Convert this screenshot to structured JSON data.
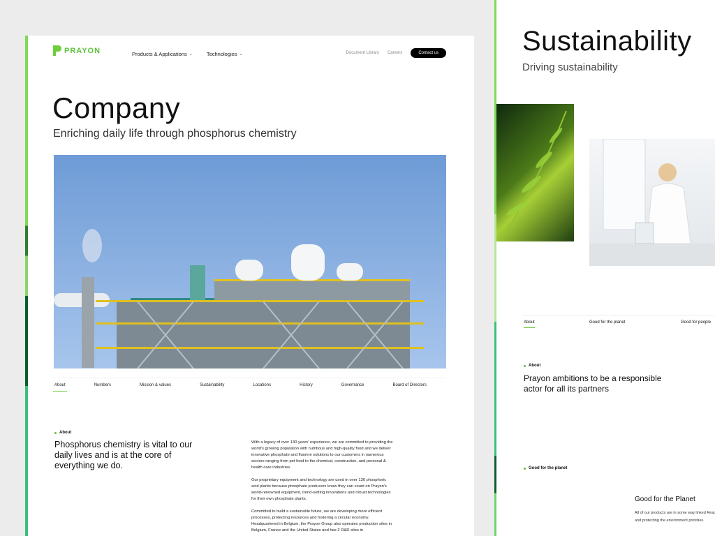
{
  "left": {
    "logo": "PRAYON",
    "nav": [
      {
        "label": "Products & Applications"
      },
      {
        "label": "Technologies"
      }
    ],
    "nav_right": {
      "library": "Document Library",
      "careers": "Careers",
      "contact": "Contact us"
    },
    "hero": {
      "title": "Company",
      "subtitle": "Enriching daily life through phosphorus chemistry"
    },
    "subnav": [
      "About",
      "Numbers",
      "Mission & values",
      "Sustainability",
      "Locations",
      "History",
      "Governance",
      "Board of Directors"
    ],
    "about": {
      "tag": "About",
      "headline": "Phosphorus chemistry is vital to our daily lives and is at the core of everything we do.",
      "paragraphs": [
        "With a legacy of over 130 years' experience, we are committed to providing the world's growing population with nutritious and high-quality food and we deliver innovative phosphate and fluorine solutions to our customers in numerous sectors ranging from pet food to the chemical, construction, and personal & health care industries.",
        "Our proprietary equipment and technology are used in over 130 phosphoric acid plants because phosphate producers know they can count on Prayon's world-renowned equipment, trend-setting innovations and robust technologies for their own phosphate plants.",
        "Committed to build a sustainable future, we are developing more efficient processes, protecting resources and fostering a circular economy. Headquartered in Belgium, the Prayon Group also operates production sites in Belgium, France and the United States and has 2 R&D sites in"
      ]
    }
  },
  "right": {
    "title": "Sustainability",
    "subtitle": "Driving sustainability",
    "tabs": [
      "About",
      "Good for the planet",
      "Good for people"
    ],
    "about_tag": "About",
    "about_headline": "Prayon ambitions to be a responsible actor for all its partners",
    "planet_tag": "Good for the planet",
    "planet_title": "Good for the Planet",
    "planet_body": "All of our products are in some way linked Respecting and protecting the environment priorities."
  },
  "colors": {
    "brand_green": "#5cc23a",
    "button_black": "#000000"
  }
}
